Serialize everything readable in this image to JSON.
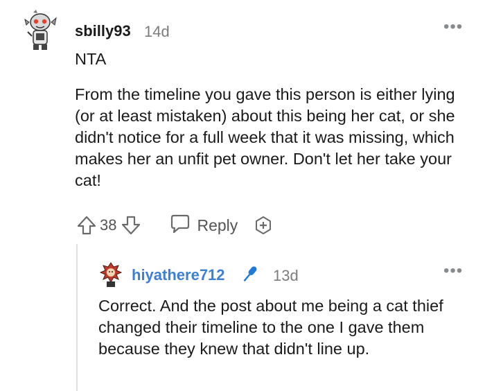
{
  "comment": {
    "username": "sbilly93",
    "age": "14d",
    "lead": "NTA",
    "body": "From the timeline you gave this person is either lying (or at least mistaken) about this being her cat, or she didn't notice for a full week that it was missing, which makes her an unfit pet owner. Don't let her take your cat!",
    "votes": "38",
    "reply_label": "Reply",
    "more_label": "•••"
  },
  "reply": {
    "username": "hiyathere712",
    "age": "13d",
    "body": "Correct. And the post about me being a cat thief changed their timeline to the one I gave them because they knew that didn't line up.",
    "more_label": "•••",
    "username_color": "#3d7fd1"
  },
  "icons": [
    "avatar",
    "upvote-icon",
    "downvote-icon",
    "chat-bubble-icon",
    "add-award-icon",
    "microphone-icon",
    "more-options-icon"
  ]
}
